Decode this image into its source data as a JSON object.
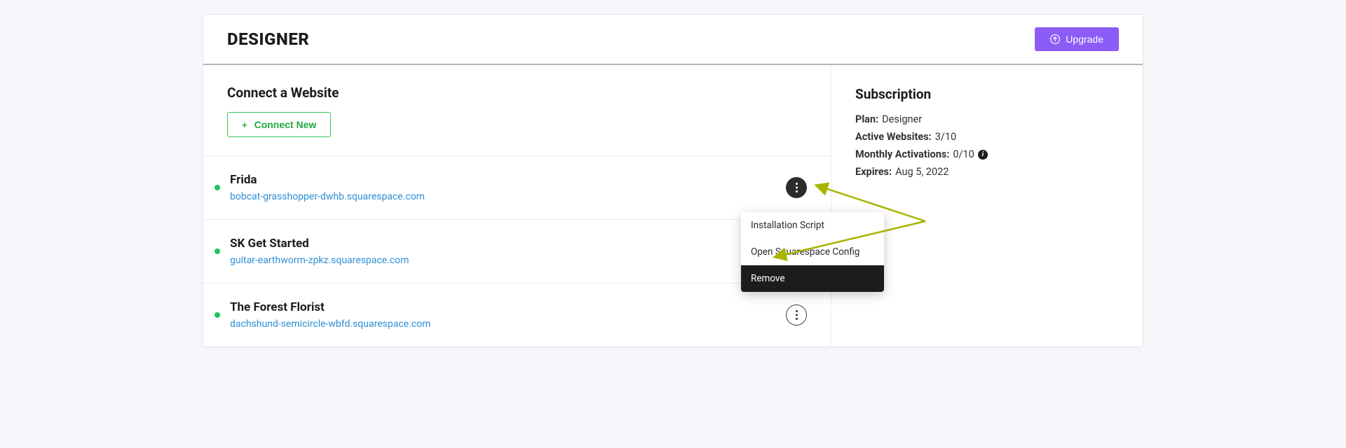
{
  "header": {
    "title": "DESIGNER",
    "upgrade_label": "Upgrade"
  },
  "connect": {
    "title": "Connect a Website",
    "button_label": "Connect New"
  },
  "sites": [
    {
      "name": "Frida",
      "url": "bobcat-grasshopper-dwhb.squarespace.com"
    },
    {
      "name": "SK Get Started",
      "url": "guitar-earthworm-zpkz.squarespace.com"
    },
    {
      "name": "The Forest Florist",
      "url": "dachshund-semicircle-wbfd.squarespace.com"
    }
  ],
  "dropdown": {
    "items": [
      "Installation Script",
      "Open Squarespace Config",
      "Remove"
    ]
  },
  "subscription": {
    "title": "Subscription",
    "plan_label": "Plan:",
    "plan_value": "Designer",
    "active_label": "Active Websites:",
    "active_value": "3/10",
    "activations_label": "Monthly Activations:",
    "activations_value": "0/10",
    "expires_label": "Expires:",
    "expires_value": "Aug 5, 2022"
  },
  "colors": {
    "accent": "#8b5cf6",
    "success": "#22c55e",
    "link": "#2d8fd6",
    "annotation": "#a8b400"
  }
}
